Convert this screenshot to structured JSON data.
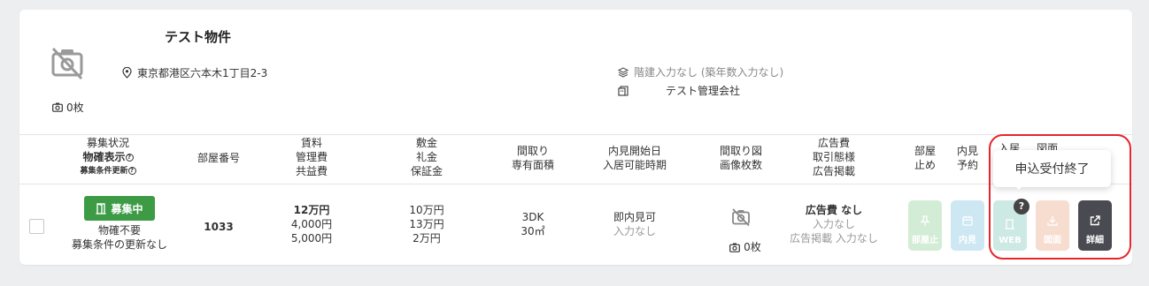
{
  "property": {
    "name": "テスト物件",
    "address": "東京都港区六本木1丁目2-3",
    "floors": "階建入力なし (築年数入力なし)",
    "management_company": "テスト管理会社",
    "photo_count": "0枚"
  },
  "headers": {
    "status": [
      "募集状況",
      "物確表示",
      "募集条件更新"
    ],
    "room_number": "部屋番号",
    "rent": [
      "賃料",
      "管理費",
      "共益費"
    ],
    "deposit": [
      "敷金",
      "礼金",
      "保証金"
    ],
    "layout": [
      "間取り",
      "専有面積"
    ],
    "viewing": [
      "内見開始日",
      "入居可能時期"
    ],
    "floorplan": [
      "間取り図",
      "画像枚数"
    ],
    "ad": [
      "広告費",
      "取引態様",
      "広告掲載"
    ],
    "room_stop": [
      "部屋",
      "止め"
    ],
    "view_reserve": [
      "内見",
      "予約"
    ],
    "clipped": "入居 ... 図面"
  },
  "row": {
    "status_badge": "募集中",
    "status_check": "物確不要",
    "status_update": "募集条件の更新なし",
    "room_number": "1033",
    "rent": "12万円",
    "management_fee": "4,000円",
    "common_fee": "5,000円",
    "deposit": "10万円",
    "key_money": "13万円",
    "guarantee": "2万円",
    "layout": "3DK",
    "area": "30㎡",
    "viewing_start": "即内見可",
    "move_in": "入力なし",
    "floorplan_count": "0枚",
    "ad_fee": "広告費 なし",
    "transaction": "入力なし",
    "ad_listing": "広告掲載 入力なし"
  },
  "actions": {
    "room_stop": "部屋止",
    "view": "内見",
    "web": "WEB",
    "drawing": "図面",
    "detail": "詳細"
  },
  "tooltip": "申込受付終了",
  "colors": {
    "badge_green": "#3d9b45",
    "highlight_red": "#e5262c",
    "detail_dark": "#4a4a52"
  }
}
